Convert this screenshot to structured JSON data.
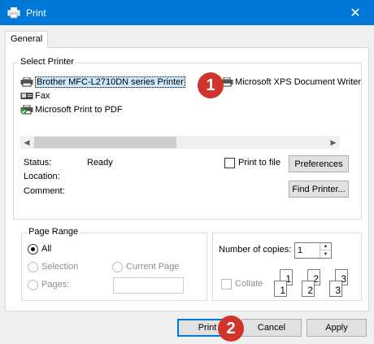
{
  "window": {
    "title": "Print",
    "close_glyph": "✕"
  },
  "tabs": [
    {
      "label": "General"
    }
  ],
  "select_printer": {
    "title": "Select Printer",
    "printers": [
      {
        "name": "Brother MFC-L2710DN series Printer"
      },
      {
        "name": "Microsoft XPS Document Writer"
      },
      {
        "name": "Fax"
      },
      {
        "name": "Microsoft Print to PDF"
      }
    ],
    "status_label": "Status:",
    "status_value": "Ready",
    "location_label": "Location:",
    "comment_label": "Comment:",
    "print_to_file_label": "Print to file",
    "preferences_label": "Preferences",
    "find_printer_label": "Find Printer..."
  },
  "page_range": {
    "title": "Page Range",
    "all_label": "All",
    "selection_label": "Selection",
    "current_page_label": "Current Page",
    "pages_label": "Pages:",
    "pages_value": ""
  },
  "copies": {
    "number_label": "Number of copies:",
    "number_value": "1",
    "collate_label": "Collate",
    "collate_pages": [
      "1",
      "1",
      "2",
      "2",
      "3",
      "3"
    ]
  },
  "buttons": {
    "print": "Print",
    "cancel": "Cancel",
    "apply": "Apply"
  },
  "annotations": [
    {
      "label": "1"
    },
    {
      "label": "2"
    }
  ],
  "colors": {
    "title_bar": "#0078d7",
    "selection": "#cce8ff",
    "marker": "#d0342c"
  }
}
